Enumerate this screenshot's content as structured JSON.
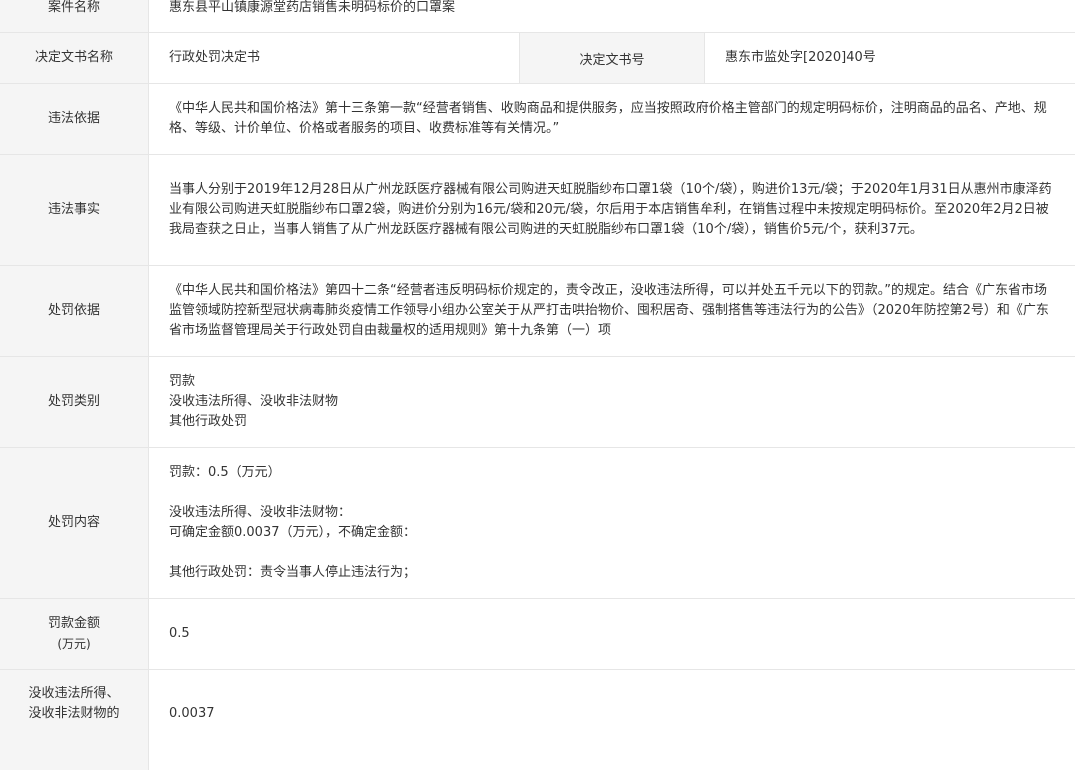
{
  "case_name": {
    "label": "案件名称",
    "value": "惠东县平山镇康源堂药店销售未明码标价的口罩案"
  },
  "decision_doc": {
    "label": "决定文书名称",
    "value": "行政处罚决定书",
    "num_label": "决定文书号",
    "num_value": "惠东市监处字[2020]40号"
  },
  "violation_basis": {
    "label": "违法依据",
    "value": "《中华人民共和国价格法》第十三条第一款“经营者销售、收购商品和提供服务，应当按照政府价格主管部门的规定明码标价，注明商品的品名、产地、规格、等级、计价单位、价格或者服务的项目、收费标准等有关情况。”"
  },
  "violation_facts": {
    "label": "违法事实",
    "value": "当事人分别于2019年12月28日从广州龙跃医疗器械有限公司购进天虹脱脂纱布口罩1袋（10个/袋），购进价13元/袋；于2020年1月31日从惠州市康泽药业有限公司购进天虹脱脂纱布口罩2袋，购进价分别为16元/袋和20元/袋，尔后用于本店销售牟利，在销售过程中未按规定明码标价。至2020年2月2日被我局查获之日止，当事人销售了从广州龙跃医疗器械有限公司购进的天虹脱脂纱布口罩1袋（10个/袋），销售价5元/个，获利37元。"
  },
  "penalty_basis": {
    "label": "处罚依据",
    "value": "《中华人民共和国价格法》第四十二条“经营者违反明码标价规定的，责令改正，没收违法所得，可以并处五千元以下的罚款。”的规定。结合《广东省市场监管领域防控新型冠状病毒肺炎疫情工作领导小组办公室关于从严打击哄抬物价、囤积居奇、强制搭售等违法行为的公告》（2020年防控第2号）和《广东省市场监督管理局关于行政处罚自由裁量权的适用规则》第十九条第（一）项"
  },
  "penalty_type": {
    "label": "处罚类别",
    "items": [
      "罚款",
      "没收违法所得、没收非法财物",
      "其他行政处罚"
    ]
  },
  "penalty_content": {
    "label": "处罚内容",
    "fine": "罚款：0.5（万元）",
    "confiscation_title": "没收违法所得、没收非法财物：",
    "confiscation_amount": "可确定金额0.0037（万元），不确定金额：",
    "other": "其他行政处罚：责令当事人停止违法行为；"
  },
  "fine_amount": {
    "label": "罚款金额",
    "unit": "(万元)",
    "value": "0.5"
  },
  "confiscation_amount": {
    "label_line1": "没收违法所得、",
    "label_line2": "没收非法财物的",
    "value": "0.0037"
  }
}
